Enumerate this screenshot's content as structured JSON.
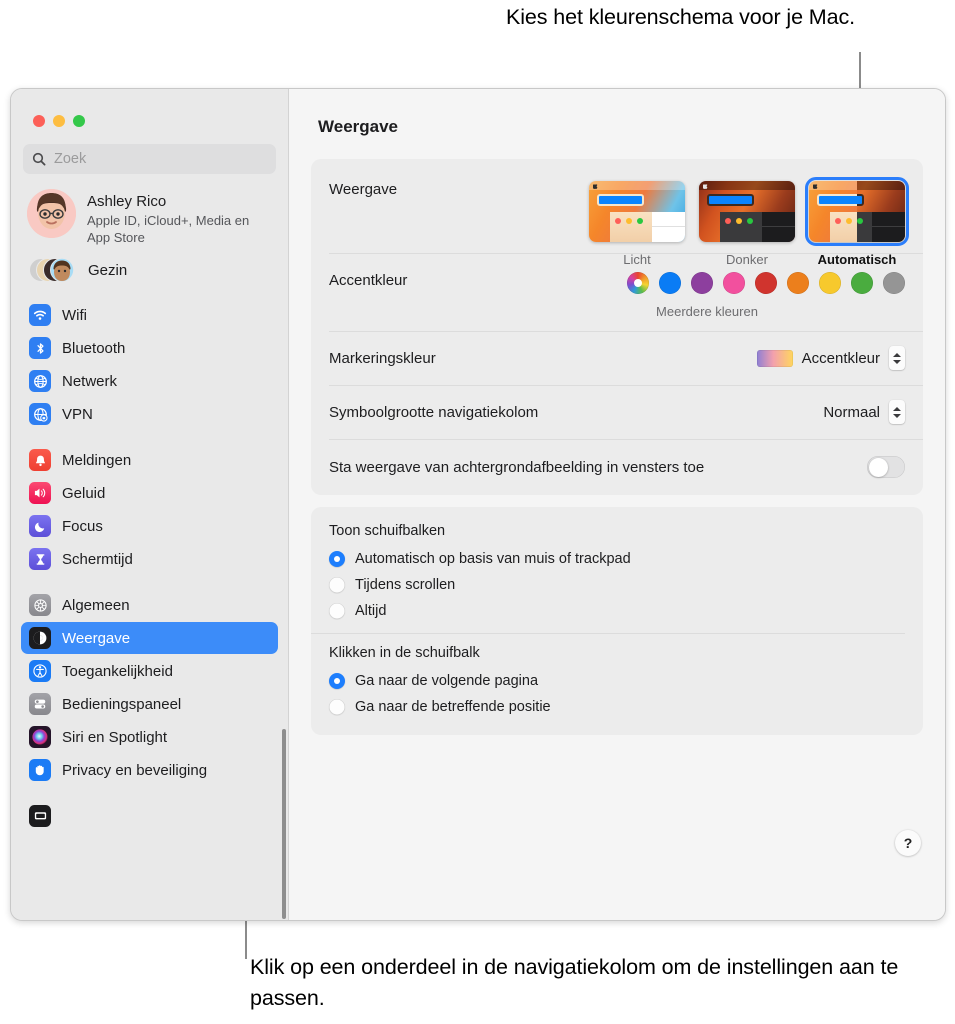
{
  "callouts": {
    "top": "Kies het kleurenschema voor je Mac.",
    "bottom": "Klik op een onderdeel in de navigatiekolom om de instellingen aan te passen."
  },
  "window": {
    "traffic_lights": [
      "close",
      "minimize",
      "zoom"
    ]
  },
  "sidebar": {
    "search": {
      "placeholder": "Zoek"
    },
    "account": {
      "name": "Ashley Rico",
      "subtitle": "Apple ID, iCloud+, Media en App Store"
    },
    "family": {
      "label": "Gezin"
    },
    "groups": [
      {
        "items": [
          {
            "label": "Wifi",
            "icon": "wifi-icon",
            "color": "#2f7ff2",
            "selected": false
          },
          {
            "label": "Bluetooth",
            "icon": "bluetooth-icon",
            "color": "#2f7ff2",
            "selected": false
          },
          {
            "label": "Netwerk",
            "icon": "globe-icon",
            "color": "#2f7ff2",
            "selected": false
          },
          {
            "label": "VPN",
            "icon": "vpn-globe-icon",
            "color": "#2f7ff2",
            "selected": false
          }
        ]
      },
      {
        "items": [
          {
            "label": "Meldingen",
            "icon": "bell-icon",
            "color": "#f0473c",
            "selected": false
          },
          {
            "label": "Geluid",
            "icon": "speaker-icon",
            "color": "#f4265e",
            "selected": false
          },
          {
            "label": "Focus",
            "icon": "moon-icon",
            "color": "#6c63e8",
            "selected": false
          },
          {
            "label": "Schermtijd",
            "icon": "hourglass-icon",
            "color": "#6c63e8",
            "selected": false
          }
        ]
      },
      {
        "items": [
          {
            "label": "Algemeen",
            "icon": "gear-icon",
            "color": "#8e8e93",
            "selected": false
          },
          {
            "label": "Weergave",
            "icon": "appearance-icon",
            "color": "#1c1c1e",
            "selected": true
          },
          {
            "label": "Toegankelijkheid",
            "icon": "accessibility-icon",
            "color": "#1b7bf5",
            "selected": false
          },
          {
            "label": "Bedieningspaneel",
            "icon": "control-center-icon",
            "color": "#8e8e93",
            "selected": false
          },
          {
            "label": "Siri en Spotlight",
            "icon": "siri-icon",
            "color": "#2b1a3a",
            "selected": false
          },
          {
            "label": "Privacy en beveiliging",
            "icon": "hand-icon",
            "color": "#1b7bf5",
            "selected": false
          }
        ]
      }
    ]
  },
  "main": {
    "title": "Weergave",
    "appearance": {
      "label": "Weergave",
      "options": [
        {
          "label": "Licht",
          "selected": false
        },
        {
          "label": "Donker",
          "selected": false
        },
        {
          "label": "Automatisch",
          "selected": true
        }
      ]
    },
    "accent": {
      "label": "Accentkleur",
      "sublabel": "Meerdere kleuren",
      "swatches": [
        {
          "name": "multicolor",
          "color": "multi"
        },
        {
          "name": "blue",
          "color": "#0a7cf5"
        },
        {
          "name": "purple",
          "color": "#8d3f9e"
        },
        {
          "name": "pink",
          "color": "#f2509e"
        },
        {
          "name": "red",
          "color": "#d0342e"
        },
        {
          "name": "orange",
          "color": "#ec7f1c"
        },
        {
          "name": "yellow",
          "color": "#f7c92d"
        },
        {
          "name": "green",
          "color": "#4aac3f"
        },
        {
          "name": "graphite",
          "color": "#959595"
        }
      ]
    },
    "highlight": {
      "label": "Markeringskleur",
      "value": "Accentkleur"
    },
    "sidebar_icon_size": {
      "label": "Symboolgrootte navigatiekolom",
      "value": "Normaal"
    },
    "wallpaper_toggle": {
      "label": "Sta weergave van achtergrondafbeelding in vensters toe",
      "on": false
    },
    "scrollbar_group": {
      "title": "Toon schuifbalken",
      "options": [
        {
          "label": "Automatisch op basis van muis of trackpad",
          "selected": true
        },
        {
          "label": "Tijdens scrollen",
          "selected": false
        },
        {
          "label": "Altijd",
          "selected": false
        }
      ]
    },
    "scrollbar_click_group": {
      "title": "Klikken in de schuifbalk",
      "options": [
        {
          "label": "Ga naar de volgende pagina",
          "selected": true
        },
        {
          "label": "Ga naar de betreffende positie",
          "selected": false
        }
      ]
    },
    "help_button": {
      "label": "?"
    }
  }
}
